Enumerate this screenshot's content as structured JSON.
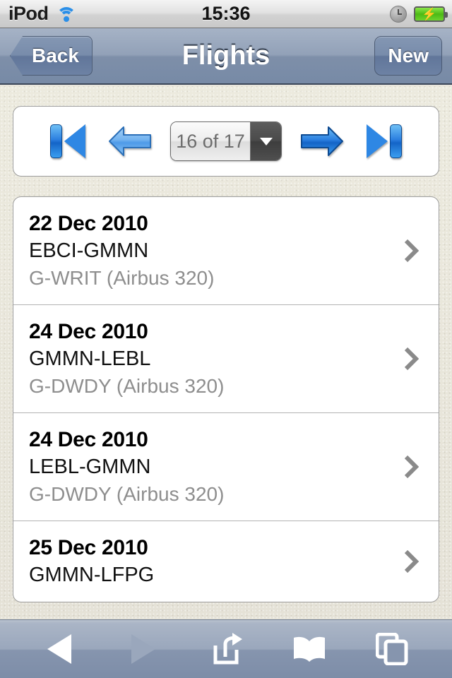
{
  "status_bar": {
    "carrier": "iPod",
    "wifi_icon": "wifi-icon",
    "time": "15:36",
    "clock_icon": "clock-icon",
    "battery_icon": "battery-charging-icon"
  },
  "nav_bar": {
    "back_label": "Back",
    "title": "Flights",
    "new_label": "New"
  },
  "pager": {
    "first_icon": "first-page-icon",
    "prev_icon": "previous-arrow-icon",
    "select_value": "16 of 17",
    "select_caret_icon": "chevron-down-icon",
    "next_icon": "next-arrow-icon",
    "last_icon": "last-page-icon",
    "current_page": 16,
    "total_pages": 17
  },
  "flights": [
    {
      "date": "22 Dec 2010",
      "route": "EBCI-GMMN",
      "aircraft": "G-WRIT (Airbus 320)",
      "chevron_icon": "chevron-right-icon"
    },
    {
      "date": "24 Dec 2010",
      "route": "GMMN-LEBL",
      "aircraft": "G-DWDY (Airbus 320)",
      "chevron_icon": "chevron-right-icon"
    },
    {
      "date": "24 Dec 2010",
      "route": "LEBL-GMMN",
      "aircraft": "G-DWDY (Airbus 320)",
      "chevron_icon": "chevron-right-icon"
    },
    {
      "date": "25 Dec 2010",
      "route": "GMMN-LFPG",
      "aircraft": "",
      "chevron_icon": "chevron-right-icon"
    }
  ],
  "toolbar": {
    "back_icon": "back-triangle-icon",
    "forward_icon": "forward-triangle-icon",
    "share_icon": "share-icon",
    "bookmarks_icon": "book-icon",
    "tabs_icon": "pages-icon"
  },
  "colors": {
    "accent_blue": "#2e87e4",
    "nav_blue_gray": "#8497b3",
    "page_background": "#e9e6dd",
    "muted_text": "#8e8e8e",
    "battery_green": "#6ed32e"
  }
}
